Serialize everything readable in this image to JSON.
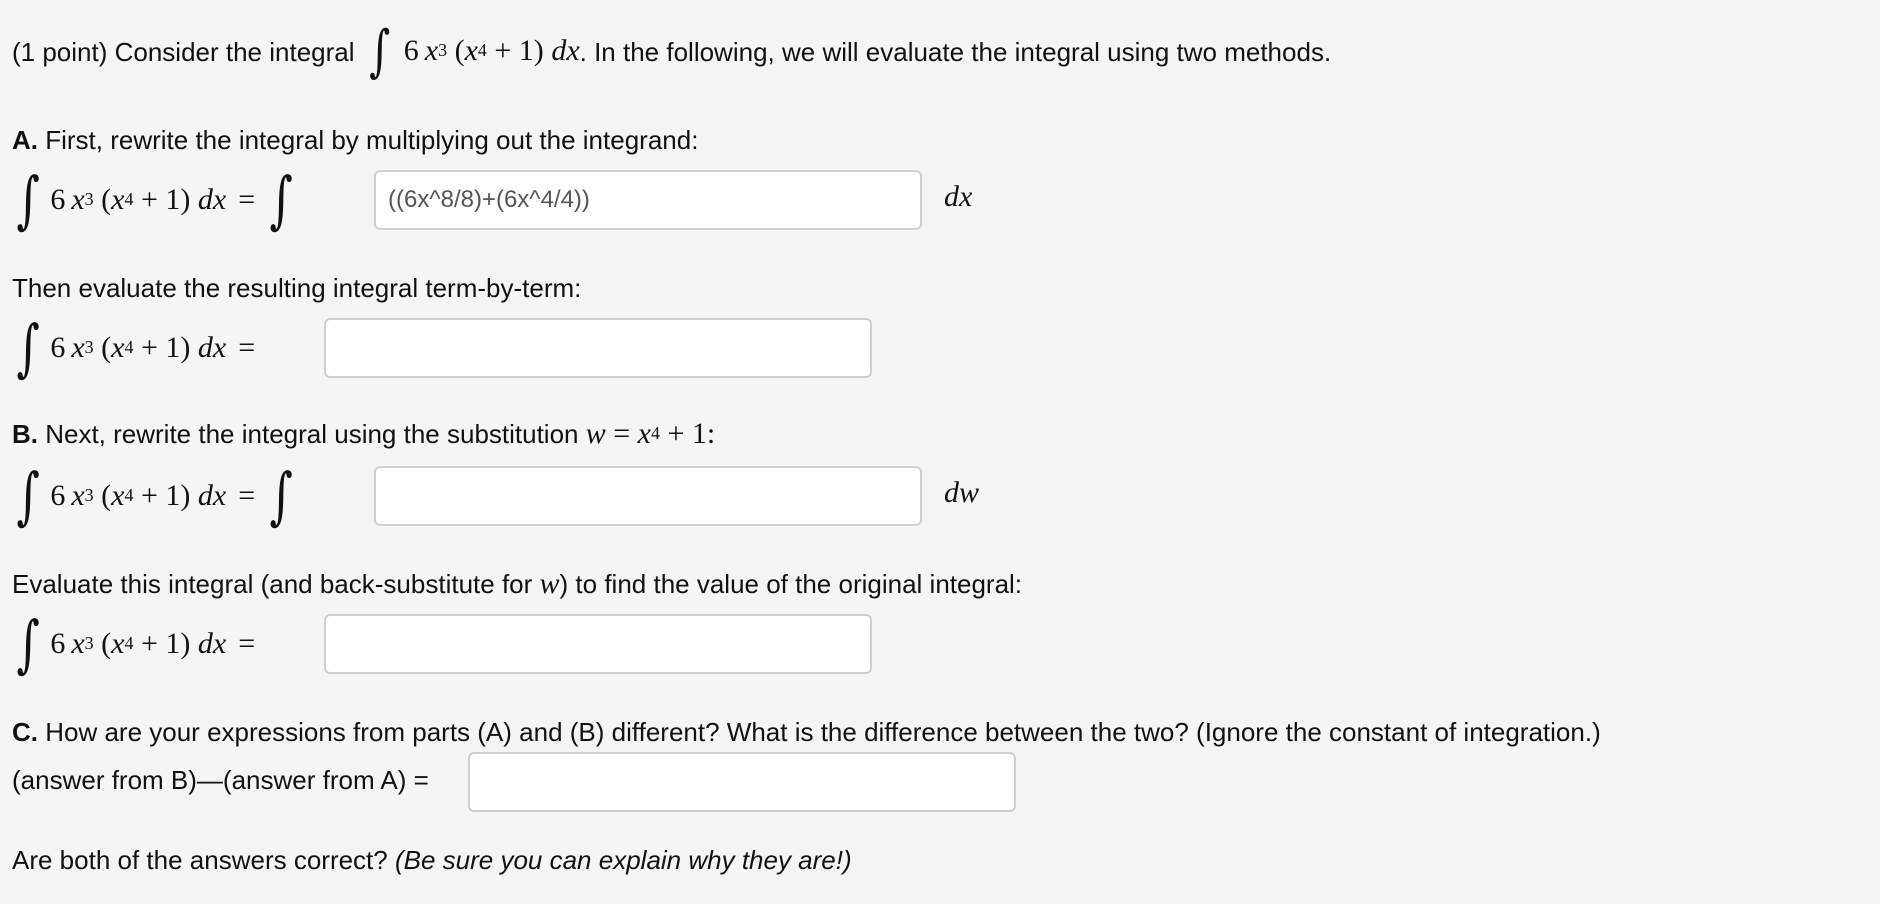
{
  "intro": {
    "prefix": "(1 point) Consider the integral",
    "suffix": ". In the following, we will evaluate the integral using two methods."
  },
  "integrand": {
    "coef": "6",
    "var": "x",
    "exp1": "3",
    "inner_var": "x",
    "exp2": "4",
    "plus_one": "+ 1)",
    "open_paren": "(",
    "d": "dx"
  },
  "part_a": {
    "label": "A.",
    "text": " First, rewrite the integral by multiplying out the integrand:",
    "input_value": "((6x^8/8)+(6x^4/4))",
    "differential": "dx"
  },
  "part_a2": {
    "text": "Then evaluate the resulting integral term-by-term:",
    "input_value": ""
  },
  "part_b": {
    "label": "B.",
    "text_before": " Next, rewrite the integral using the substitution ",
    "sub_var": "w",
    "sub_eq": " = ",
    "sub_x": "x",
    "sub_exp": "4",
    "sub_tail": " + 1:",
    "input_value": "",
    "differential": "dw"
  },
  "part_b2": {
    "text_before": "Evaluate this integral (and back-substitute for ",
    "var": "w",
    "text_after": ") to find the value of the original integral:",
    "input_value": ""
  },
  "part_c": {
    "label": "C.",
    "text": " How are your expressions from parts (A) and (B) different? What is the difference between the two? (Ignore the constant of integration.)",
    "diff_label": "(answer from B)—(answer from A) =",
    "input_value": ""
  },
  "footer": {
    "question": "Are both of the answers correct? ",
    "note": "(Be sure you can explain why they are!)"
  }
}
